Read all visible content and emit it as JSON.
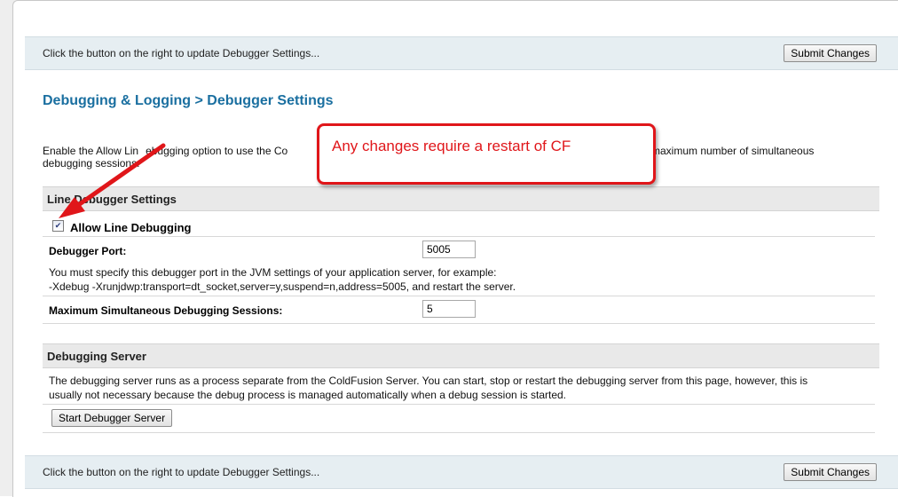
{
  "top_bar": {
    "message": "Click the button on the right to update Debugger Settings...",
    "submit_label": "Submit Changes"
  },
  "page": {
    "title": "Debugging & Logging > Debugger Settings",
    "description_start": "Enable the Allow Line Debugging option to use the ColdFusion Debugger. Specify the port and the maximum number of simultaneous",
    "description_start_visible": "Enable the Allow Lin",
    "description_mid_visible": "ebugging option to use the Co",
    "description_tail": "maximum number of simultaneous",
    "description_line2": "debugging sessions."
  },
  "line_debugger": {
    "header": "Line Debugger Settings",
    "allow_label": "Allow Line Debugging",
    "allow_checked": true,
    "port_label": "Debugger Port:",
    "port_value": "5005",
    "port_note_1": "You must specify this debugger port in the JVM settings of your application server, for example:",
    "port_note_2": "-Xdebug -Xrunjdwp:transport=dt_socket,server=y,suspend=n,address=5005, and restart the server.",
    "max_label": "Maximum Simultaneous Debugging Sessions:",
    "max_value": "5"
  },
  "debugging_server": {
    "header": "Debugging Server",
    "note_1": "The debugging server runs as a process separate from the ColdFusion Server. You can start, stop or restart the debugging server from this page, however, this is",
    "note_2": "usually not necessary because the debug process is managed automatically when a debug session is started.",
    "start_label": "Start Debugger Server"
  },
  "bottom_bar": {
    "message": "Click the button on the right to update Debugger Settings...",
    "submit_label": "Submit Changes"
  },
  "annotation": {
    "text": "Any changes require a restart of CF",
    "color": "#e0161a"
  },
  "icons": {
    "checkbox": "check-icon",
    "arrow": "red-arrow-icon"
  }
}
